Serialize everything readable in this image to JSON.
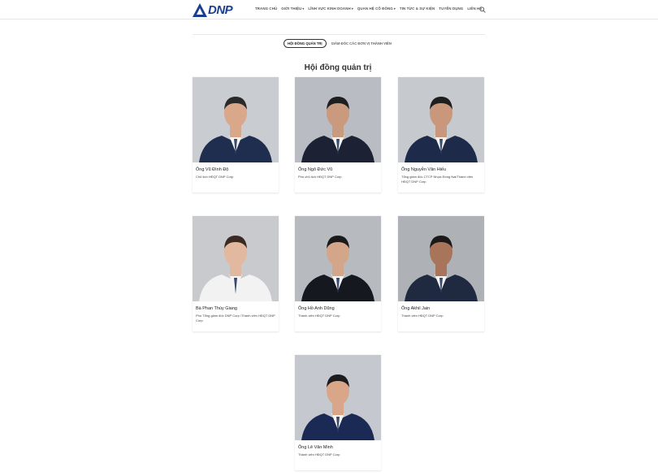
{
  "brand": {
    "logo_text": "DNP",
    "accent": "#1b3f8f"
  },
  "nav": {
    "items": [
      {
        "label": "Trang chủ",
        "dropdown": false
      },
      {
        "label": "Giới thiệu",
        "dropdown": true
      },
      {
        "label": "Lĩnh vực kinh doanh",
        "dropdown": true
      },
      {
        "label": "Quan hệ cổ đông",
        "dropdown": true
      },
      {
        "label": "Tin tức & sự kiện",
        "dropdown": false
      },
      {
        "label": "Tuyển dụng",
        "dropdown": false
      },
      {
        "label": "Liên hệ",
        "dropdown": false
      }
    ],
    "search_icon": "search-icon"
  },
  "tabs": [
    {
      "label": "Hội đồng quản trị",
      "active": true
    },
    {
      "label": "Giám đốc các đơn vị thành viên",
      "active": false
    }
  ],
  "section_title": "Hội đồng quản trị",
  "members": [
    {
      "name": "Ông Vũ Đình Độ",
      "role": "Chủ tịch HĐQT DNP Corp",
      "bg": "#c9ccd0",
      "suit": "#1f2d4f",
      "skin": "#d9a88a",
      "hair": "#2a2a2a"
    },
    {
      "name": "Ông Ngô Đức Vũ",
      "role": "Phó chủ tịch HĐQT DNP Corp",
      "bg": "#b9bcc2",
      "suit": "#1c2233",
      "skin": "#c99a7e",
      "hair": "#1e1e1e"
    },
    {
      "name": "Ông Nguyễn Văn Hiếu",
      "role": "Tổng giám đốc CTCP Nhựa Đồng Nai/Thành viên HĐQT DNP Corp",
      "bg": "#c6c9ce",
      "suit": "#1e2a4a",
      "skin": "#c9987c",
      "hair": "#1e1e1e"
    },
    {
      "name": "Bà Phan Thùy Giang",
      "role": "Phó Tổng giám đốc DNP Corp /Thành viên HĐQT DNP Corp",
      "bg": "#c8cace",
      "suit": "#f2f2f2",
      "skin": "#e2b89e",
      "hair": "#3a2a22"
    },
    {
      "name": "Ông Hồ Anh Dũng",
      "role": "Thành viên HĐQT DNP Corp",
      "bg": "#b7babf",
      "suit": "#15181f",
      "skin": "#d3a68a",
      "hair": "#1a1a1a"
    },
    {
      "name": "Ông Akhil Jain",
      "role": "Thành viên HĐQT DNP Corp",
      "bg": "#aeb1b6",
      "suit": "#1f2a40",
      "skin": "#a8745a",
      "hair": "#1a1a1a"
    },
    {
      "name": "Ông Lê Văn Minh",
      "role": "Thành viên HĐQT DNP Corp",
      "bg": "#c5c9cf",
      "suit": "#1a2a55",
      "skin": "#d9a68a",
      "hair": "#1c1c1c"
    }
  ]
}
